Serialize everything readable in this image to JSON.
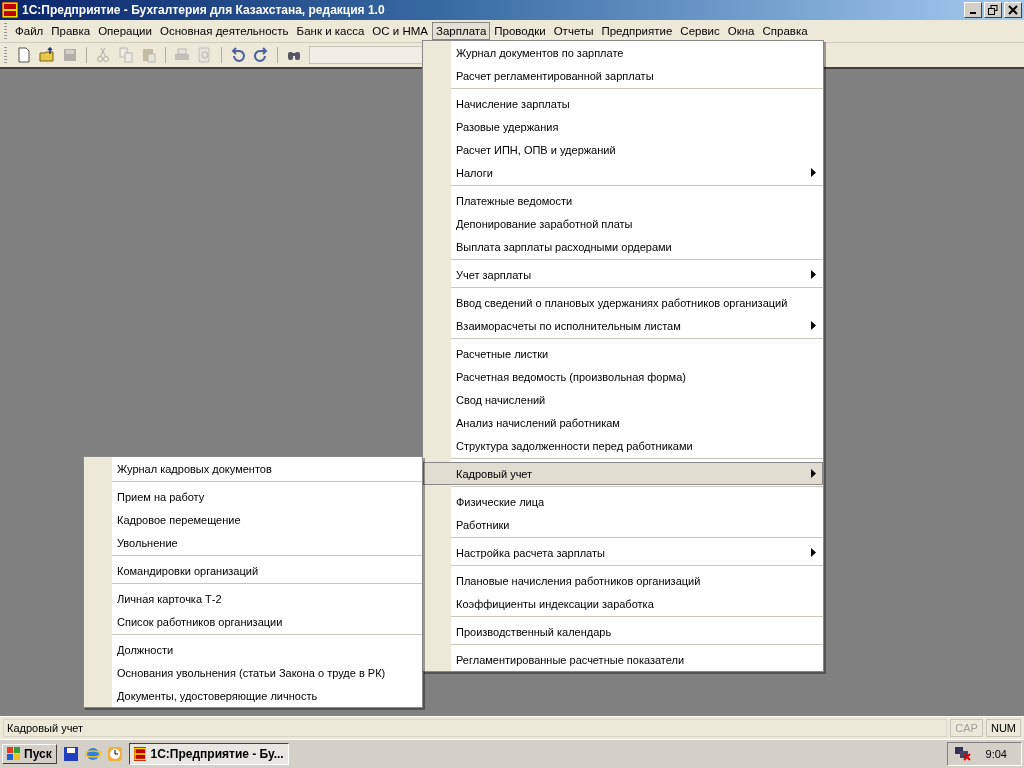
{
  "window": {
    "title": "1С:Предприятие - Бухгалтерия для Казахстана, редакция 1.0"
  },
  "menubar": [
    {
      "label": "Файл",
      "selected": false
    },
    {
      "label": "Правка",
      "selected": false
    },
    {
      "label": "Операции",
      "selected": false
    },
    {
      "label": "Основная деятельность",
      "selected": false
    },
    {
      "label": "Банк и касса",
      "selected": false
    },
    {
      "label": "ОС и НМА",
      "selected": false
    },
    {
      "label": "Зарплата",
      "selected": true
    },
    {
      "label": "Проводки",
      "selected": false
    },
    {
      "label": "Отчеты",
      "selected": false
    },
    {
      "label": "Предприятие",
      "selected": false
    },
    {
      "label": "Сервис",
      "selected": false
    },
    {
      "label": "Окна",
      "selected": false
    },
    {
      "label": "Справка",
      "selected": false
    }
  ],
  "toolbar": [
    {
      "kind": "new",
      "disabled": false
    },
    {
      "kind": "open",
      "disabled": false
    },
    {
      "kind": "save",
      "disabled": true
    },
    {
      "kind": "sep"
    },
    {
      "kind": "cut",
      "disabled": true
    },
    {
      "kind": "copy",
      "disabled": true
    },
    {
      "kind": "paste",
      "disabled": true
    },
    {
      "kind": "sep"
    },
    {
      "kind": "print",
      "disabled": true
    },
    {
      "kind": "preview",
      "disabled": true
    },
    {
      "kind": "sep"
    },
    {
      "kind": "undo",
      "disabled": false
    },
    {
      "kind": "redo",
      "disabled": false
    },
    {
      "kind": "sep"
    },
    {
      "kind": "find",
      "disabled": false
    }
  ],
  "menu": [
    {
      "kind": "item",
      "label": "Журнал документов по зарплате",
      "submenu": false,
      "selected": false
    },
    {
      "kind": "item",
      "label": "Расчет регламентированной зарплаты",
      "submenu": false,
      "selected": false
    },
    {
      "kind": "separator"
    },
    {
      "kind": "item",
      "label": "Начисление зарплаты",
      "submenu": false,
      "selected": false
    },
    {
      "kind": "item",
      "label": "Разовые удержания",
      "submenu": false,
      "selected": false
    },
    {
      "kind": "item",
      "label": "Расчет ИПН, ОПВ и удержаний",
      "submenu": false,
      "selected": false
    },
    {
      "kind": "item",
      "label": "Налоги",
      "submenu": true,
      "selected": false
    },
    {
      "kind": "separator"
    },
    {
      "kind": "item",
      "label": "Платежные ведомости",
      "submenu": false,
      "selected": false
    },
    {
      "kind": "item",
      "label": "Депонирование заработной платы",
      "submenu": false,
      "selected": false
    },
    {
      "kind": "item",
      "label": "Выплата зарплаты расходными ордерами",
      "submenu": false,
      "selected": false
    },
    {
      "kind": "separator"
    },
    {
      "kind": "item",
      "label": "Учет зарплаты",
      "submenu": true,
      "selected": false
    },
    {
      "kind": "separator"
    },
    {
      "kind": "item",
      "label": "Ввод сведений о плановых удержаниях работников организаций",
      "submenu": false,
      "selected": false
    },
    {
      "kind": "item",
      "label": "Взаиморасчеты по исполнительным листам",
      "submenu": true,
      "selected": false
    },
    {
      "kind": "separator"
    },
    {
      "kind": "item",
      "label": "Расчетные листки",
      "submenu": false,
      "selected": false
    },
    {
      "kind": "item",
      "label": "Расчетная ведомость (произвольная форма)",
      "submenu": false,
      "selected": false
    },
    {
      "kind": "item",
      "label": "Свод начислений",
      "submenu": false,
      "selected": false
    },
    {
      "kind": "item",
      "label": "Анализ начислений работникам",
      "submenu": false,
      "selected": false
    },
    {
      "kind": "item",
      "label": "Структура задолженности перед работниками",
      "submenu": false,
      "selected": false
    },
    {
      "kind": "separator"
    },
    {
      "kind": "item",
      "label": "Кадровый учет",
      "submenu": true,
      "selected": true
    },
    {
      "kind": "separator"
    },
    {
      "kind": "item",
      "label": "Физические лица",
      "submenu": false,
      "selected": false
    },
    {
      "kind": "item",
      "label": "Работники",
      "submenu": false,
      "selected": false
    },
    {
      "kind": "separator"
    },
    {
      "kind": "item",
      "label": "Настройка расчета зарплаты",
      "submenu": true,
      "selected": false
    },
    {
      "kind": "separator"
    },
    {
      "kind": "item",
      "label": "Плановые начисления работников организаций",
      "submenu": false,
      "selected": false
    },
    {
      "kind": "item",
      "label": "Коэффициенты индексации заработка",
      "submenu": false,
      "selected": false
    },
    {
      "kind": "separator"
    },
    {
      "kind": "item",
      "label": "Производственный календарь",
      "submenu": false,
      "selected": false
    },
    {
      "kind": "separator"
    },
    {
      "kind": "item",
      "label": "Регламентированные расчетные показатели",
      "submenu": false,
      "selected": false
    }
  ],
  "submenu": [
    {
      "kind": "item",
      "label": "Журнал кадровых документов",
      "selected": false
    },
    {
      "kind": "separator"
    },
    {
      "kind": "item",
      "label": "Прием на работу",
      "selected": false
    },
    {
      "kind": "item",
      "label": "Кадровое перемещение",
      "selected": false
    },
    {
      "kind": "item",
      "label": "Увольнение",
      "selected": false
    },
    {
      "kind": "separator"
    },
    {
      "kind": "item",
      "label": "Командировки организаций",
      "selected": false
    },
    {
      "kind": "separator"
    },
    {
      "kind": "item",
      "label": "Личная карточка Т-2",
      "selected": false
    },
    {
      "kind": "item",
      "label": "Список работников организации",
      "selected": false
    },
    {
      "kind": "separator"
    },
    {
      "kind": "item",
      "label": "Должности",
      "selected": false
    },
    {
      "kind": "item",
      "label": "Основания увольнения (статьи Закона о труде в РК)",
      "selected": false
    },
    {
      "kind": "item",
      "label": "Документы, удостоверяющие личность",
      "selected": false
    }
  ],
  "status_bar": {
    "text": "Кадровый учет",
    "indicators": [
      {
        "label": "CAP",
        "on": false
      },
      {
        "label": "NUM",
        "on": true
      }
    ]
  },
  "taskbar": {
    "start": "Пуск",
    "task": "1С:Предприятие - Бу...",
    "clock": "9:04"
  }
}
